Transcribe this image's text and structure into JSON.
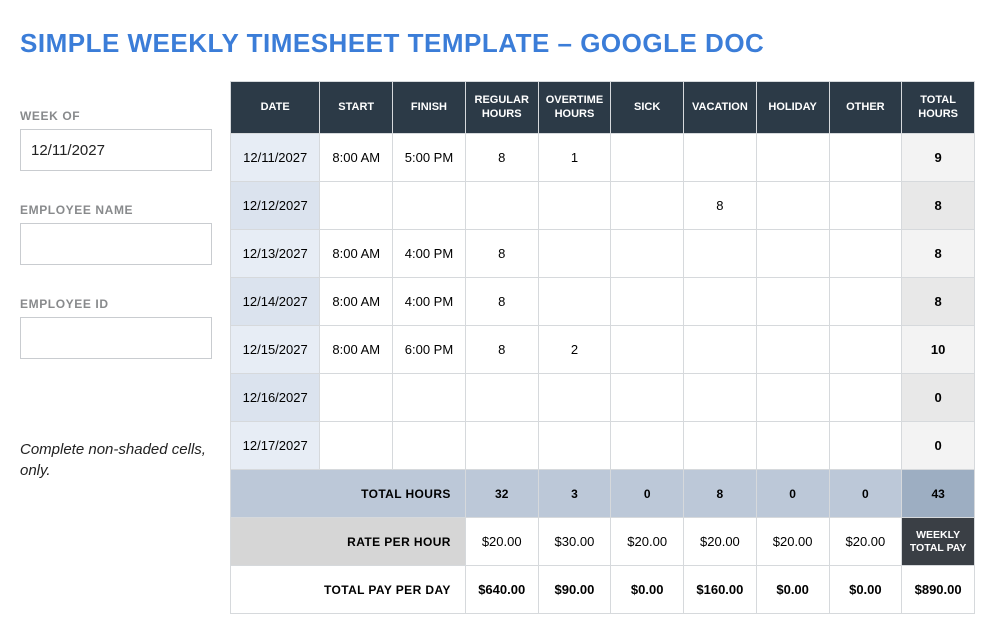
{
  "title": "SIMPLE WEEKLY TIMESHEET TEMPLATE – GOOGLE DOC",
  "side": {
    "week_of_label": "WEEK OF",
    "week_of_value": "12/11/2027",
    "employee_name_label": "EMPLOYEE NAME",
    "employee_name_value": "",
    "employee_id_label": "EMPLOYEE ID",
    "employee_id_value": "",
    "note": "Complete non-shaded cells, only."
  },
  "headers": {
    "date": "DATE",
    "start": "START",
    "finish": "FINISH",
    "regular": "REGULAR HOURS",
    "overtime": "OVERTIME HOURS",
    "sick": "SICK",
    "vacation": "VACATION",
    "holiday": "HOLIDAY",
    "other": "OTHER",
    "total": "TOTAL HOURS"
  },
  "rows": [
    {
      "date": "12/11/2027",
      "start": "8:00 AM",
      "finish": "5:00 PM",
      "regular": "8",
      "overtime": "1",
      "sick": "",
      "vacation": "",
      "holiday": "",
      "other": "",
      "total": "9"
    },
    {
      "date": "12/12/2027",
      "start": "",
      "finish": "",
      "regular": "",
      "overtime": "",
      "sick": "",
      "vacation": "8",
      "holiday": "",
      "other": "",
      "total": "8"
    },
    {
      "date": "12/13/2027",
      "start": "8:00 AM",
      "finish": "4:00 PM",
      "regular": "8",
      "overtime": "",
      "sick": "",
      "vacation": "",
      "holiday": "",
      "other": "",
      "total": "8"
    },
    {
      "date": "12/14/2027",
      "start": "8:00 AM",
      "finish": "4:00 PM",
      "regular": "8",
      "overtime": "",
      "sick": "",
      "vacation": "",
      "holiday": "",
      "other": "",
      "total": "8"
    },
    {
      "date": "12/15/2027",
      "start": "8:00 AM",
      "finish": "6:00 PM",
      "regular": "8",
      "overtime": "2",
      "sick": "",
      "vacation": "",
      "holiday": "",
      "other": "",
      "total": "10"
    },
    {
      "date": "12/16/2027",
      "start": "",
      "finish": "",
      "regular": "",
      "overtime": "",
      "sick": "",
      "vacation": "",
      "holiday": "",
      "other": "",
      "total": "0"
    },
    {
      "date": "12/17/2027",
      "start": "",
      "finish": "",
      "regular": "",
      "overtime": "",
      "sick": "",
      "vacation": "",
      "holiday": "",
      "other": "",
      "total": "0"
    }
  ],
  "totals": {
    "label": "TOTAL HOURS",
    "regular": "32",
    "overtime": "3",
    "sick": "0",
    "vacation": "8",
    "holiday": "0",
    "other": "0",
    "grand": "43"
  },
  "rate": {
    "label": "RATE PER HOUR",
    "regular": "$20.00",
    "overtime": "$30.00",
    "sick": "$20.00",
    "vacation": "$20.00",
    "holiday": "$20.00",
    "other": "$20.00",
    "weekly_label": "WEEKLY TOTAL PAY"
  },
  "payday": {
    "label": "TOTAL PAY PER DAY",
    "regular": "$640.00",
    "overtime": "$90.00",
    "sick": "$0.00",
    "vacation": "$160.00",
    "holiday": "$0.00",
    "other": "$0.00",
    "grand": "$890.00"
  }
}
